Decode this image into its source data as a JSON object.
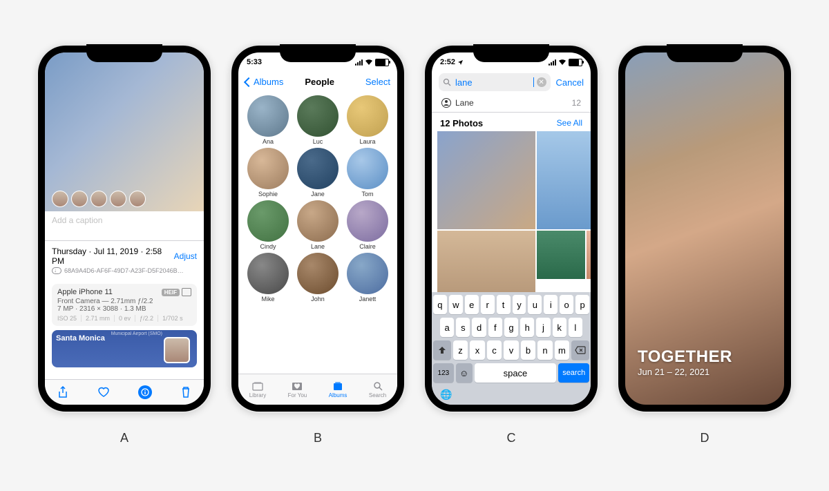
{
  "labels": [
    "A",
    "B",
    "C",
    "D"
  ],
  "phoneA": {
    "caption_placeholder": "Add a caption",
    "date_line": "Thursday · Jul 11, 2019 · 2:58 PM",
    "adjust": "Adjust",
    "file_id": "68A9A4D6-AF6F-49D7-A23F-D5F2046B…",
    "device": "Apple iPhone 11",
    "format_badge": "HEIF",
    "lens": "Front Camera — 2.71mm ƒ/2.2",
    "res": "7 MP · 2316 × 3088 · 1.3 MB",
    "exif": [
      "ISO 25",
      "2.71 mm",
      "0 ev",
      "ƒ/2.2",
      "1/702 s"
    ],
    "map_label": "Santa Monica",
    "map_sub": "Municipal Airport (SMO)"
  },
  "phoneB": {
    "time": "5:33",
    "back": "Albums",
    "title": "People",
    "right": "Select",
    "people": [
      "Ana",
      "Luc",
      "Laura",
      "Sophie",
      "Jane",
      "Tom",
      "Cindy",
      "Lane",
      "Claire",
      "Mike",
      "John",
      "Janett"
    ],
    "tabs": [
      "Library",
      "For You",
      "Albums",
      "Search"
    ],
    "active_tab": 2
  },
  "phoneC": {
    "time": "2:52",
    "query": "lane",
    "cancel": "Cancel",
    "suggestion": "Lane",
    "suggestion_count": "12",
    "section_title": "12 Photos",
    "see_all": "See All",
    "keyboard": {
      "row1": [
        "q",
        "w",
        "e",
        "r",
        "t",
        "y",
        "u",
        "i",
        "o",
        "p"
      ],
      "row2": [
        "a",
        "s",
        "d",
        "f",
        "g",
        "h",
        "j",
        "k",
        "l"
      ],
      "row3": [
        "z",
        "x",
        "c",
        "v",
        "b",
        "n",
        "m"
      ],
      "nums": "123",
      "space": "space",
      "search": "search"
    }
  },
  "phoneD": {
    "title": "TOGETHER",
    "date": "Jun 21 – 22, 2021"
  }
}
